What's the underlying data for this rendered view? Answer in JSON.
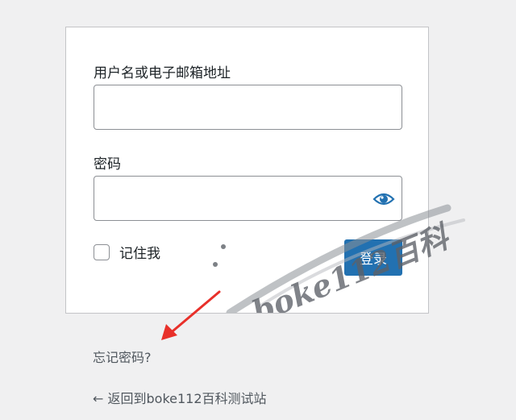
{
  "form": {
    "username_label": "用户名或电子邮箱地址",
    "username_value": "",
    "password_label": "密码",
    "password_value": "",
    "remember_label": "记住我",
    "submit_label": "登录"
  },
  "links": {
    "lost_password": "忘记密码?",
    "back_to_site": "← 返回到boke112百科测试站"
  },
  "overlay": {
    "watermark_text": "boke112百科",
    "arrow_color": "#e8302a"
  },
  "colors": {
    "primary_button": "#2271b1",
    "page_background": "#f0f0f1"
  },
  "icons": {
    "eye": "eye-icon"
  }
}
